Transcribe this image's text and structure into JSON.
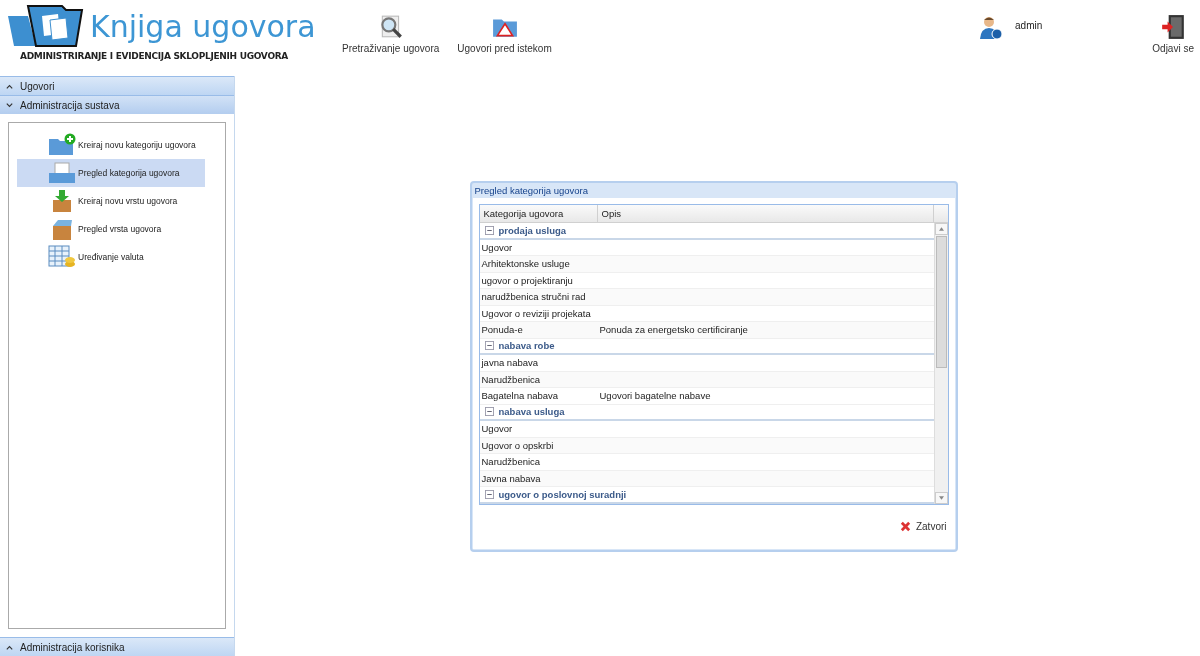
{
  "header": {
    "title": "Knjiga ugovora",
    "subtitle": "ADMINISTRIRANJE I EVIDENCIJA SKLOPLJENIH UGOVORA",
    "toolbar": [
      {
        "label": "Pretraživanje ugovora",
        "kind": "search"
      },
      {
        "label": "Ugovori pred istekom",
        "kind": "warning"
      }
    ],
    "user": "admin",
    "logout": "Odjavi se"
  },
  "sidebar": {
    "sections": [
      {
        "title": "Ugovori",
        "expanded": false
      },
      {
        "title": "Administracija sustava",
        "expanded": true,
        "items": [
          {
            "label": "Kreiraj novu kategoriju ugovora",
            "kind": "add-category",
            "selected": false
          },
          {
            "label": "Pregled kategorija ugovora",
            "kind": "categories",
            "selected": true
          },
          {
            "label": "Kreiraj novu vrstu ugovora",
            "kind": "add-type",
            "selected": false
          },
          {
            "label": "Pregled vrsta ugovora",
            "kind": "types",
            "selected": false
          },
          {
            "label": "Uređivanje valuta",
            "kind": "currencies",
            "selected": false
          }
        ]
      },
      {
        "title": "Administracija korisnika",
        "expanded": false
      }
    ]
  },
  "dialog": {
    "title": "Pregled kategorija ugovora",
    "columns": [
      "Kategorija ugovora",
      "Opis"
    ],
    "groups": [
      {
        "name": "prodaja usluga",
        "expanded": true,
        "rows": [
          {
            "category": "Ugovor"
          },
          {
            "category": "Arhitektonske usluge"
          },
          {
            "category": "ugovor o projektiranju"
          },
          {
            "category": "narudžbenica stručni rad"
          },
          {
            "category": "Ugovor o reviziji projekata"
          },
          {
            "category": "Ponuda-e",
            "description": "Ponuda za energetsko certificiranje"
          }
        ]
      },
      {
        "name": "nabava robe",
        "expanded": true,
        "rows": [
          {
            "category": "javna nabava"
          },
          {
            "category": "Narudžbenica"
          },
          {
            "category": "Bagatelna nabava",
            "description": "Ugovori bagatelne nabave"
          }
        ]
      },
      {
        "name": "nabava usluga",
        "expanded": true,
        "rows": [
          {
            "category": "Ugovor"
          },
          {
            "category": "Ugovor o opskrbi"
          },
          {
            "category": "Narudžbenica"
          },
          {
            "category": "Javna nabava"
          }
        ]
      },
      {
        "name": "ugovor o poslovnoj suradnji",
        "expanded": true
      }
    ],
    "close": "Zatvori"
  }
}
